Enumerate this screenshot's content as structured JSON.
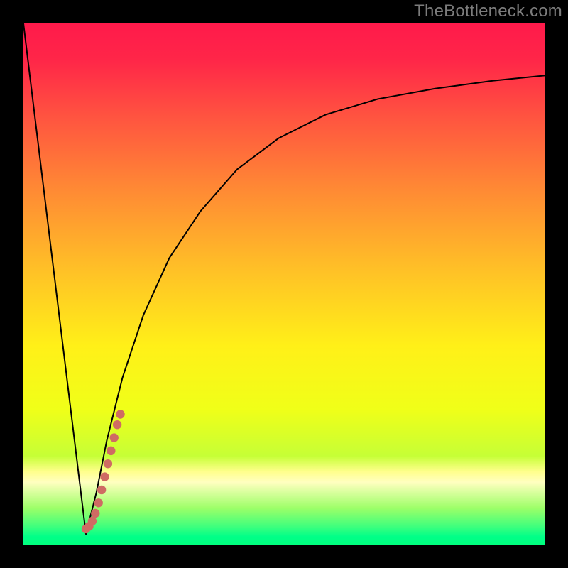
{
  "watermark": "TheBottleneck.com",
  "colors": {
    "frame": "#000000",
    "curve": "#000000",
    "dots": "#cf6b63",
    "gradient_stops": [
      {
        "offset": 0.0,
        "color": "#ff1a4b"
      },
      {
        "offset": 0.07,
        "color": "#ff2648"
      },
      {
        "offset": 0.18,
        "color": "#ff5440"
      },
      {
        "offset": 0.32,
        "color": "#ff8a34"
      },
      {
        "offset": 0.48,
        "color": "#ffc326"
      },
      {
        "offset": 0.62,
        "color": "#fff018"
      },
      {
        "offset": 0.74,
        "color": "#f0ff18"
      },
      {
        "offset": 0.83,
        "color": "#c6ff36"
      },
      {
        "offset": 0.86,
        "color": "#ffff8c"
      },
      {
        "offset": 0.88,
        "color": "#ffffc0"
      },
      {
        "offset": 0.93,
        "color": "#9dff68"
      },
      {
        "offset": 0.965,
        "color": "#40ff7d"
      },
      {
        "offset": 0.985,
        "color": "#00ff88"
      },
      {
        "offset": 1.0,
        "color": "#00ff7e"
      }
    ]
  },
  "chart_data": {
    "type": "line",
    "title": "",
    "xlabel": "",
    "ylabel": "",
    "xlim": [
      0,
      100
    ],
    "ylim": [
      0,
      100
    ],
    "series": [
      {
        "name": "left-slope",
        "x": [
          0,
          12
        ],
        "y": [
          100,
          2
        ]
      },
      {
        "name": "right-curve",
        "x": [
          12,
          14,
          16,
          19,
          23,
          28,
          34,
          41,
          49,
          58,
          68,
          79,
          90,
          100
        ],
        "y": [
          2,
          10,
          20,
          32,
          44,
          55,
          64,
          72,
          78,
          82.5,
          85.5,
          87.5,
          89,
          90
        ]
      }
    ],
    "highlight_dots": {
      "name": "recommended-range",
      "points": [
        {
          "x": 12.0,
          "y": 3.0
        },
        {
          "x": 12.6,
          "y": 3.5
        },
        {
          "x": 13.2,
          "y": 4.5
        },
        {
          "x": 13.8,
          "y": 6.0
        },
        {
          "x": 14.4,
          "y": 8.0
        },
        {
          "x": 15.0,
          "y": 10.5
        },
        {
          "x": 15.6,
          "y": 13.0
        },
        {
          "x": 16.2,
          "y": 15.5
        },
        {
          "x": 16.8,
          "y": 18.0
        },
        {
          "x": 17.4,
          "y": 20.5
        },
        {
          "x": 18.0,
          "y": 23.0
        },
        {
          "x": 18.6,
          "y": 25.0
        }
      ]
    }
  }
}
